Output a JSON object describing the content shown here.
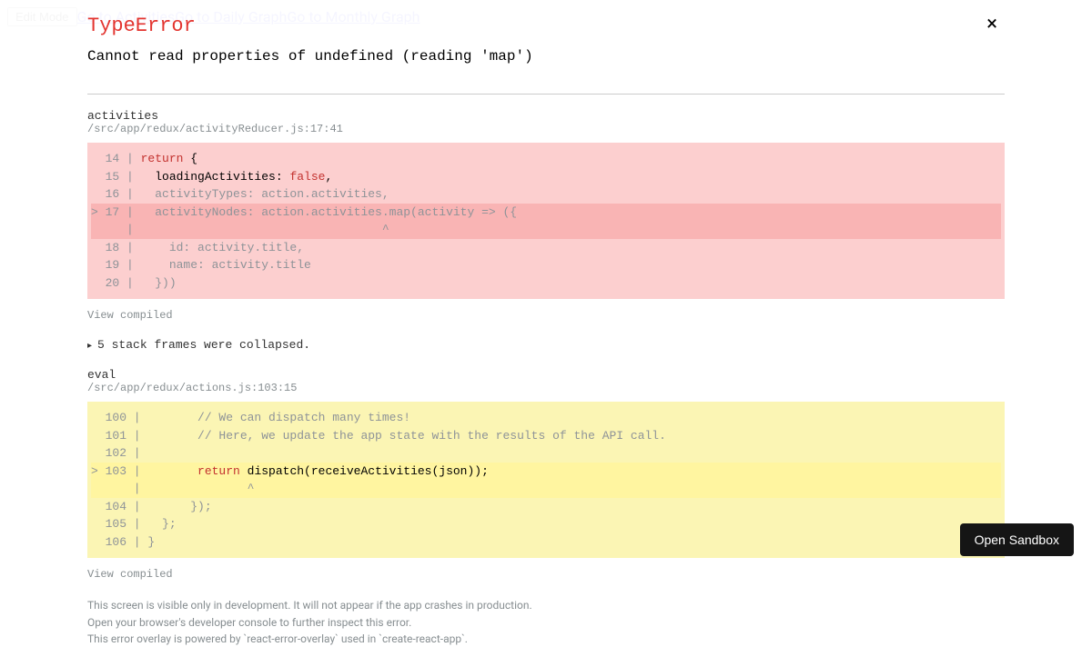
{
  "bg": {
    "edit": "Edit Mode",
    "link1": "Go to Activities",
    "link2": "Go to Daily Graph",
    "link3": "Go to Monthly Graph"
  },
  "error": {
    "title": "TypeError",
    "message": "Cannot read properties of undefined (reading 'map')"
  },
  "frame1": {
    "func": "activities",
    "file": "/src/app/redux/activityReducer.js:17:41",
    "code": {
      "l14_gutter": "  14 | ",
      "l14_kw": "return",
      "l14_rest": " {",
      "l15_gutter": "  15 | ",
      "l15_a": "  loadingActivities: ",
      "l15_kw": "false",
      "l15_b": ",",
      "l16": "  16 |   activityTypes: action.activities,",
      "l17": "> 17 |   activityNodes: action.activities.map(activity => ({",
      "l17caret": "     |                                   ^",
      "l18": "  18 |     id: activity.title,",
      "l19": "  19 |     name: activity.title",
      "l20": "  20 |   }))"
    },
    "view": "View compiled"
  },
  "collapsed": "5 stack frames were collapsed.",
  "frame2": {
    "func": "eval",
    "file": "/src/app/redux/actions.js:103:15",
    "code": {
      "l100": "  100 |        // We can dispatch many times!",
      "l101": "  101 |        // Here, we update the app state with the results of the API call.",
      "l102": "  102 | ",
      "l103_gutter": "> 103 | ",
      "l103_pad": "       ",
      "l103_kw": "return",
      "l103_rest": " dispatch(receiveActivities(json));",
      "l103caret": "      |               ^",
      "l104": "  104 |       });",
      "l105": "  105 |   };",
      "l106": "  106 | }"
    },
    "view": "View compiled"
  },
  "footer": {
    "l1": "This screen is visible only in development. It will not appear if the app crashes in production.",
    "l2": "Open your browser's developer console to further inspect this error.",
    "l3": "This error overlay is powered by `react-error-overlay` used in `create-react-app`."
  },
  "sandbox": "Open Sandbox"
}
